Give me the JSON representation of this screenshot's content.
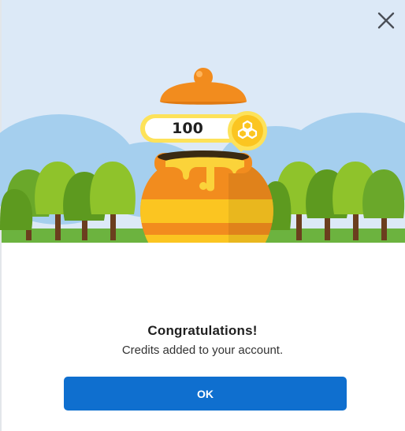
{
  "dialog": {
    "credits_amount": "100",
    "title": "Congratulations!",
    "message": "Credits added to your account.",
    "ok_label": "OK"
  },
  "icons": {
    "close": "close-icon",
    "coin": "honeycomb-coin-icon"
  },
  "colors": {
    "sky": "#dce9f7",
    "cloud": "#9ac8ec",
    "tree_dark": "#5d9a1f",
    "tree_light": "#8fc32b",
    "grass": "#6cb33f",
    "trunk": "#6b3e1e",
    "pot_orange": "#f28c1e",
    "pot_yellow": "#fbc521",
    "honey": "#fbd33a",
    "button": "#0f6fcf"
  }
}
